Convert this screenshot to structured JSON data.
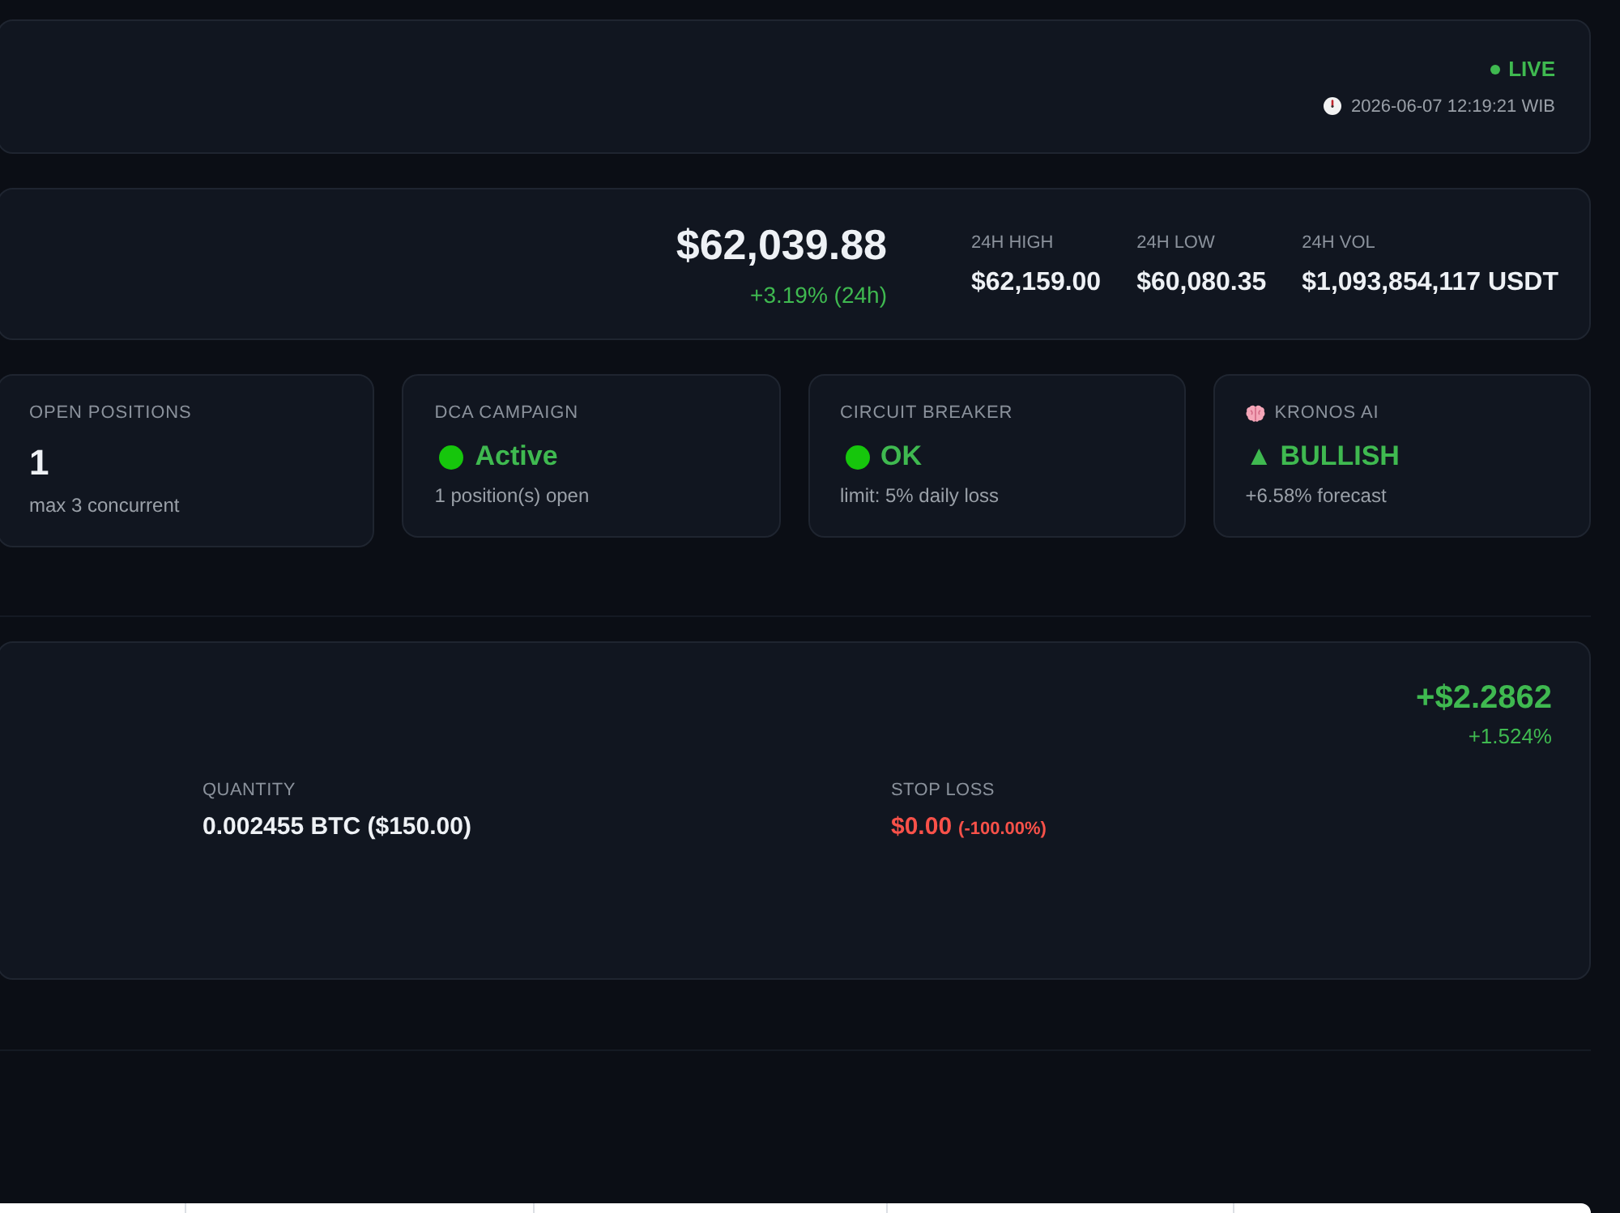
{
  "header": {
    "status": "LIVE",
    "timestamp": "2026-06-07 12:19:21 WIB"
  },
  "ticker": {
    "price": "$62,039.88",
    "change": "+3.19% (24h)",
    "stats": [
      {
        "label": "24H HIGH",
        "value": "$62,159.00"
      },
      {
        "label": "24H LOW",
        "value": "$60,080.35"
      },
      {
        "label": "24H VOL",
        "value": "$1,093,854,117 USDT"
      }
    ]
  },
  "stat_cards": [
    {
      "kind": "count",
      "label": "OPEN POSITIONS",
      "value": "1",
      "note": "max 3 concurrent"
    },
    {
      "kind": "status",
      "label": "DCA CAMPAIGN",
      "value": "Active",
      "color": "#16c60c",
      "note": "1 position(s) open"
    },
    {
      "kind": "status",
      "label": "CIRCUIT BREAKER",
      "value": "OK",
      "color": "#16c60c",
      "note": "limit: 5% daily loss"
    },
    {
      "kind": "signal",
      "label": "KRONOS AI",
      "value": "▲ BULLISH",
      "note": "+6.58% forecast"
    }
  ],
  "position": {
    "pnl": "+$2.2862",
    "pnl_percent": "+1.524%",
    "fields": [
      {
        "kind": "plain",
        "label": "QUANTITY",
        "value": "0.002455 BTC ($150.00)"
      },
      {
        "kind": "loss",
        "label": "STOP LOSS",
        "value": "$0.00",
        "note": "(-100.00%)"
      }
    ]
  }
}
